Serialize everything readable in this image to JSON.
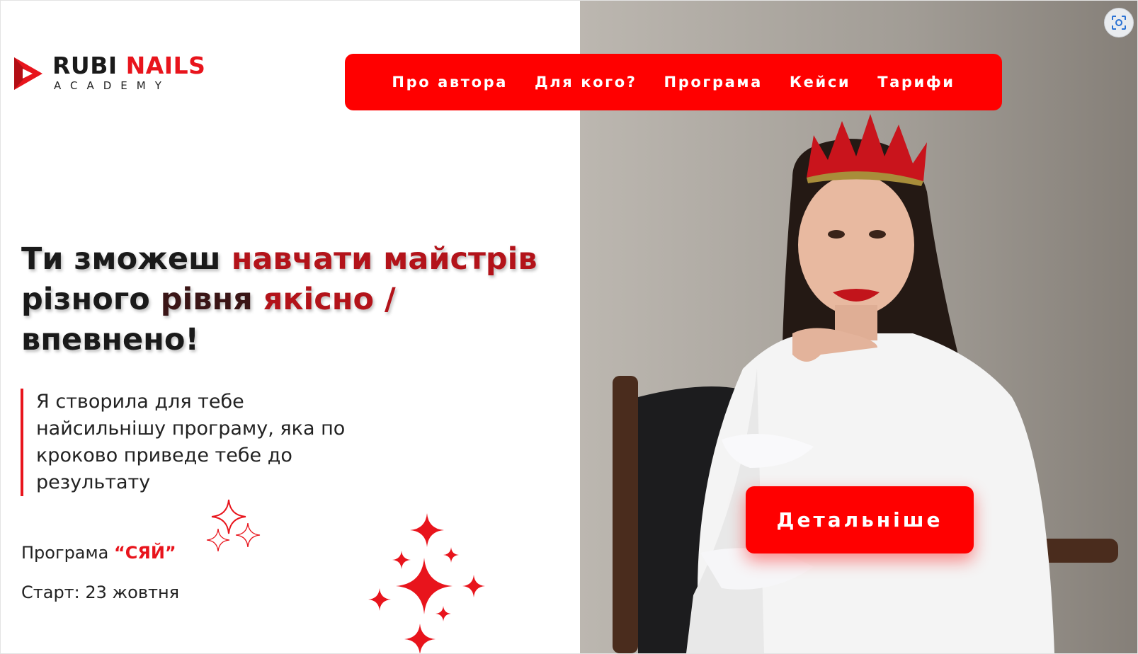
{
  "brand": {
    "word1": "RUBI",
    "word2": "NAILS",
    "sub": "ACADEMY",
    "accent": "#e8141c"
  },
  "nav": {
    "items": [
      "Про автора",
      "Для кого?",
      "Програма",
      "Кейси",
      "Тарифи"
    ],
    "bg": "#ff0000"
  },
  "hero": {
    "h1": "Ти зможеш ",
    "h2": "навчати майстрів",
    "h3": "різного ",
    "h4": "рівня",
    "h5": " якісно /",
    "h6": "впевнено!",
    "quote": "Я створила для тебе найсильнішу програму, яка по кроково приведе тебе до результату",
    "program_label": "Програма ",
    "program_name": "“СЯЙ”",
    "start": "Старт: 23 жовтня"
  },
  "cta": {
    "label": "Детальніше"
  },
  "icons": {
    "lens": "screenshot-lens-icon"
  }
}
